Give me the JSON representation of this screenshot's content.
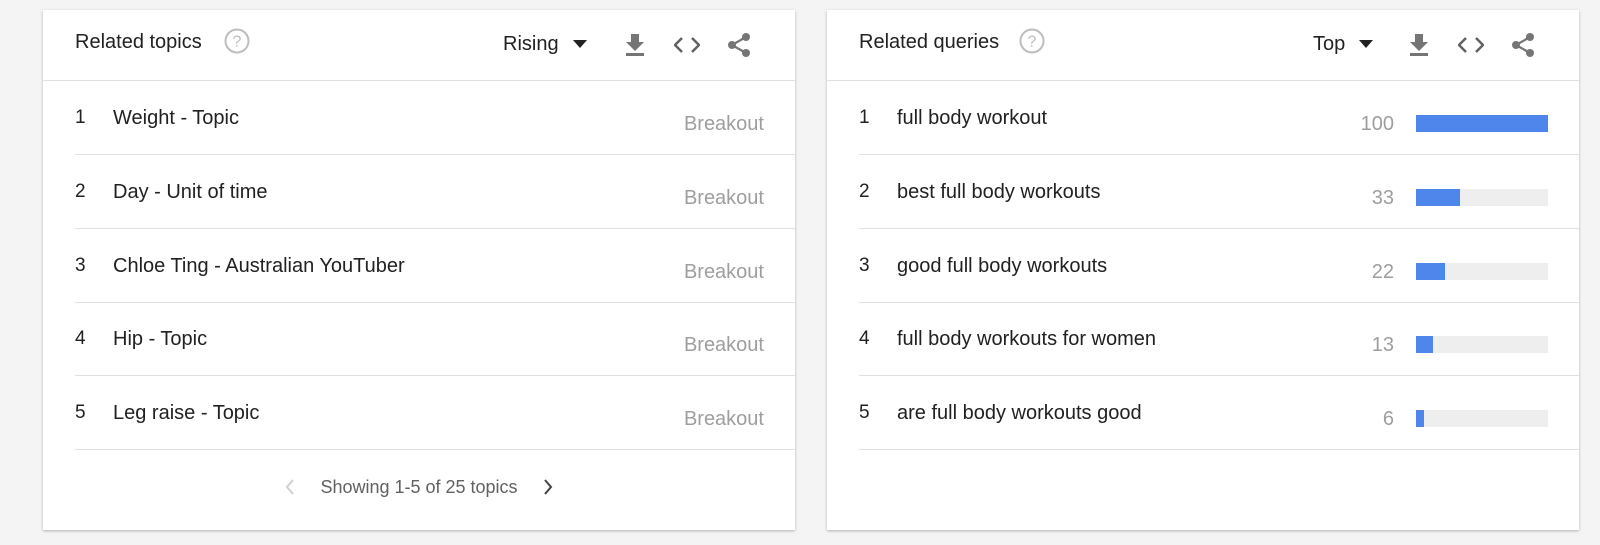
{
  "related_topics": {
    "title": "Related topics",
    "selector_value": "Rising",
    "icons": [
      "help-icon",
      "download-icon",
      "embed-code-icon",
      "share-icon"
    ],
    "rows": [
      {
        "rank": "1",
        "label": "Weight - Topic",
        "value": "Breakout"
      },
      {
        "rank": "2",
        "label": "Day - Unit of time",
        "value": "Breakout"
      },
      {
        "rank": "3",
        "label": "Chloe Ting - Australian YouTuber",
        "value": "Breakout"
      },
      {
        "rank": "4",
        "label": "Hip - Topic",
        "value": "Breakout"
      },
      {
        "rank": "5",
        "label": "Leg raise - Topic",
        "value": "Breakout"
      }
    ],
    "pagination_text": "Showing 1-5 of 25 topics"
  },
  "related_queries": {
    "title": "Related queries",
    "selector_value": "Top",
    "icons": [
      "help-icon",
      "download-icon",
      "embed-code-icon",
      "share-icon"
    ],
    "rows": [
      {
        "rank": "1",
        "label": "full body workout",
        "score": 100
      },
      {
        "rank": "2",
        "label": "best full body workouts",
        "score": 33
      },
      {
        "rank": "3",
        "label": "good full body workouts",
        "score": 22
      },
      {
        "rank": "4",
        "label": "full body workouts for women",
        "score": 13
      },
      {
        "rank": "5",
        "label": "are full body workouts good",
        "score": 6
      }
    ],
    "score_max": 100
  },
  "colors": {
    "bar_fill": "#4f86ec",
    "bar_track": "#eeeeee",
    "muted_text": "#9e9e9e",
    "icon": "#757575"
  }
}
